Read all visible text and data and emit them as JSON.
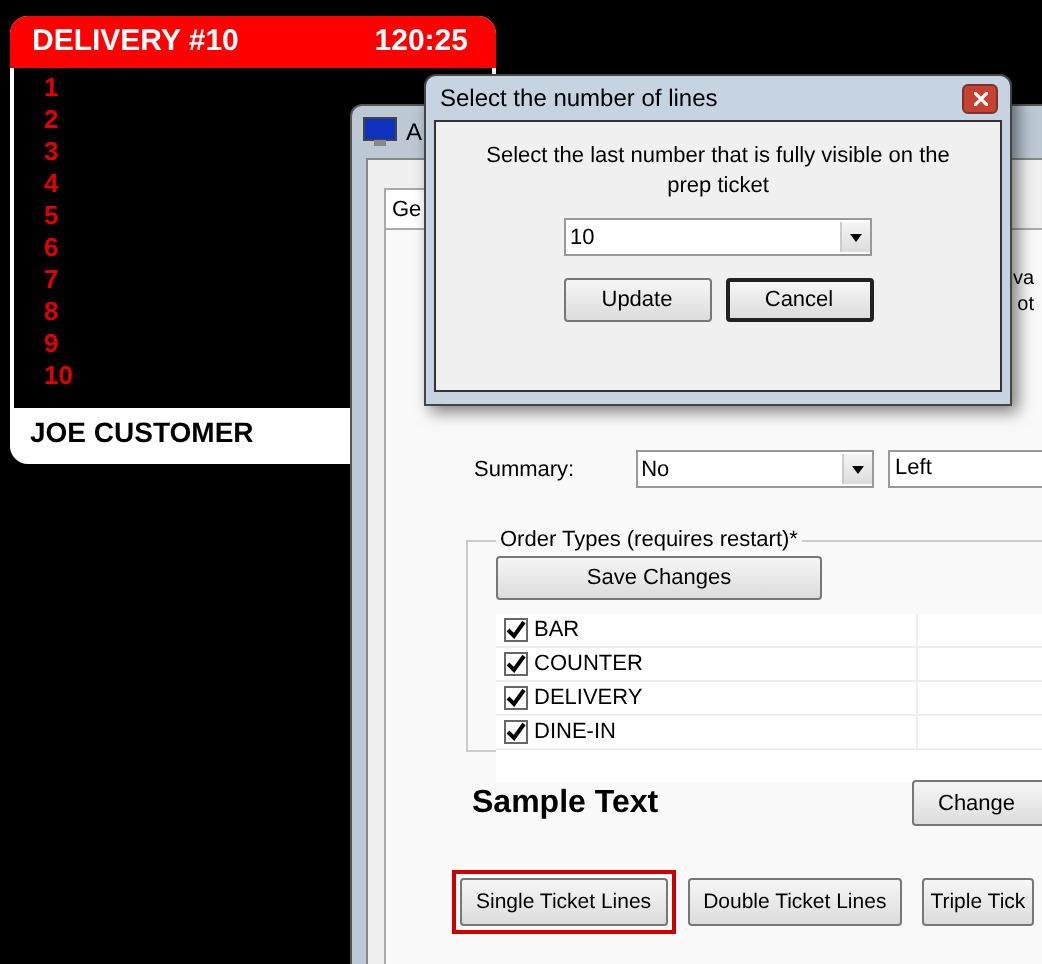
{
  "ticket": {
    "title": "DELIVERY #10",
    "timer": "120:25",
    "lines": [
      "1",
      "2",
      "3",
      "4",
      "5",
      "6",
      "7",
      "8",
      "9",
      "10"
    ],
    "customer": "JOE CUSTOMER"
  },
  "settings_window": {
    "title": "A",
    "tab": "Ge",
    "fragments": [
      "va",
      "ot"
    ],
    "summary": {
      "label": "Summary:",
      "value": "No",
      "alignment": "Left"
    },
    "order_types": {
      "legend": "Order Types (requires restart)*",
      "save_button": "Save Changes",
      "items": [
        {
          "label": "BAR",
          "checked": true
        },
        {
          "label": "COUNTER",
          "checked": true
        },
        {
          "label": "DELIVERY",
          "checked": true
        },
        {
          "label": "DINE-IN",
          "checked": true
        }
      ]
    },
    "sample_text": "Sample Text",
    "change_button": "Change",
    "line_buttons": [
      {
        "label": "Single Ticket Lines",
        "selected": true
      },
      {
        "label": "Double Ticket Lines",
        "selected": false
      },
      {
        "label": "Triple Tick",
        "selected": false
      }
    ]
  },
  "dialog": {
    "title": "Select the number of lines",
    "message": "Select the last number that is fully visible on the prep ticket",
    "value": "10",
    "buttons": [
      {
        "label": "Update",
        "focused": false
      },
      {
        "label": "Cancel",
        "focused": true
      }
    ]
  }
}
